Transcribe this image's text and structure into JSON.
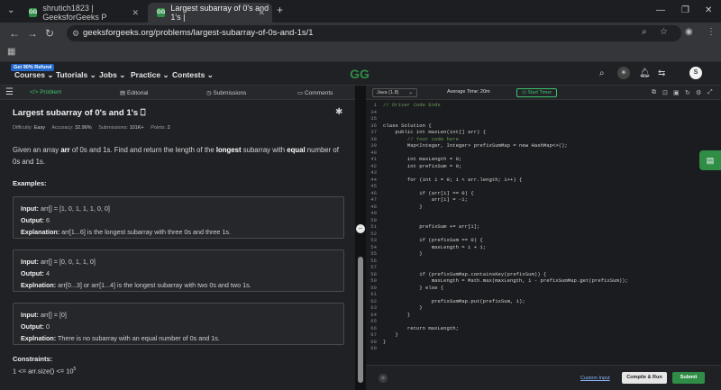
{
  "browser": {
    "tabs": [
      {
        "title": "shrutich1823 | GeeksforGeeks P",
        "close": "✕"
      },
      {
        "title": "Largest subarray of 0's and 1's |",
        "close": "✕"
      }
    ],
    "new_tab": "+",
    "url": "geeksforgeeks.org/problems/largest-subarray-of-0s-and-1s/1"
  },
  "site": {
    "promo": "Get 90% Refund",
    "menu": [
      "Courses ⌄",
      "Tutorials ⌄",
      "Jobs ⌄",
      "Practice ⌄",
      "Contests ⌄"
    ],
    "logo": "GG",
    "avatar": "S",
    "brand_color": "#2f8d46"
  },
  "subtabs": [
    "</> Problem",
    "Editorial",
    "Submissions",
    "Comments"
  ],
  "problem": {
    "title": "Largest subarray of 0's and 1's",
    "difficulty_label": "Difficulty:",
    "difficulty": "Easy",
    "accuracy_label": "Accuracy:",
    "accuracy": "32.96%",
    "submissions_label": "Submissions:",
    "submissions": "101K+",
    "points_label": "Points:",
    "points": "2",
    "desc_1": "Given an array ",
    "desc_arr": "arr",
    "desc_2": " of 0s and 1s. Find and return the length of the ",
    "desc_longest": "longest",
    "desc_3": " subarray with ",
    "desc_equal": "equal",
    "desc_4": " number of 0s and 1s.",
    "examples_heading": "Examples:",
    "examples": [
      {
        "in_label": "Input:",
        "input": "arr[] = [1, 0, 1, 1, 1, 0, 0]",
        "out_label": "Output:",
        "output": "6",
        "exp_label": "Explanation:",
        "explanation": "arr[1...6] is the longest subarray with three 0s and three 1s."
      },
      {
        "in_label": "Input:",
        "input": "arr[] = [0, 0, 1, 1, 0]",
        "out_label": "Output:",
        "output": "4",
        "exp_label": "Explnation:",
        "explanation": "arr[0...3] or arr[1...4] is the longest subarray with two 0s and two 1s."
      },
      {
        "in_label": "Input:",
        "input": "arr[] = [0]",
        "out_label": "Output:",
        "output": "0",
        "exp_label": "Explnation:",
        "explanation": "There is no subarray with an equal number of 0s and 1s."
      }
    ],
    "constraints_heading": "Constraints:",
    "constraint_1": "1 <= arr.size() <= 10",
    "constraint_1_exp": "5"
  },
  "editor": {
    "language": "Java (1.8)",
    "avg_time_label": "Average Time:",
    "avg_time": "20m",
    "timer": "Start Timer",
    "custom_input": "Custom Input",
    "compile_run": "Compile & Run",
    "submit": "Submit"
  },
  "code_lines": [
    {
      "n": "1",
      "t": "// Driver Code Ends"
    },
    {
      "n": "34",
      "t": ""
    },
    {
      "n": "35",
      "t": ""
    },
    {
      "n": "36",
      "t": "class Solution {"
    },
    {
      "n": "37",
      "t": "    public int maxLen(int[] arr) {"
    },
    {
      "n": "38",
      "t": "        // Your code here"
    },
    {
      "n": "39",
      "t": "        Map<Integer, Integer> prefixSumMap = new HashMap<>();"
    },
    {
      "n": "40",
      "t": ""
    },
    {
      "n": "41",
      "t": "        int maxLength = 0;"
    },
    {
      "n": "42",
      "t": "        int prefixSum = 0;"
    },
    {
      "n": "43",
      "t": ""
    },
    {
      "n": "44",
      "t": "        for (int i = 0; i < arr.length; i++) {"
    },
    {
      "n": "45",
      "t": ""
    },
    {
      "n": "46",
      "t": "            if (arr[i] == 0) {"
    },
    {
      "n": "47",
      "t": "                arr[i] = -1;"
    },
    {
      "n": "48",
      "t": "            }"
    },
    {
      "n": "49",
      "t": ""
    },
    {
      "n": "50",
      "t": ""
    },
    {
      "n": "51",
      "t": "            prefixSum += arr[i];"
    },
    {
      "n": "52",
      "t": ""
    },
    {
      "n": "53",
      "t": "            if (prefixSum == 0) {"
    },
    {
      "n": "54",
      "t": "                maxLength = i + 1;"
    },
    {
      "n": "55",
      "t": "            }"
    },
    {
      "n": "56",
      "t": ""
    },
    {
      "n": "57",
      "t": ""
    },
    {
      "n": "58",
      "t": "            if (prefixSumMap.containsKey(prefixSum)) {"
    },
    {
      "n": "59",
      "t": "                maxLength = Math.max(maxLength, i - prefixSumMap.get(prefixSum));"
    },
    {
      "n": "60",
      "t": "            } else {"
    },
    {
      "n": "61",
      "t": ""
    },
    {
      "n": "62",
      "t": "                prefixSumMap.put(prefixSum, i);"
    },
    {
      "n": "63",
      "t": "            }"
    },
    {
      "n": "64",
      "t": "        }"
    },
    {
      "n": "65",
      "t": ""
    },
    {
      "n": "66",
      "t": "        return maxLength;"
    },
    {
      "n": "67",
      "t": "    }"
    },
    {
      "n": "68",
      "t": "}"
    },
    {
      "n": "69",
      "t": ""
    }
  ]
}
